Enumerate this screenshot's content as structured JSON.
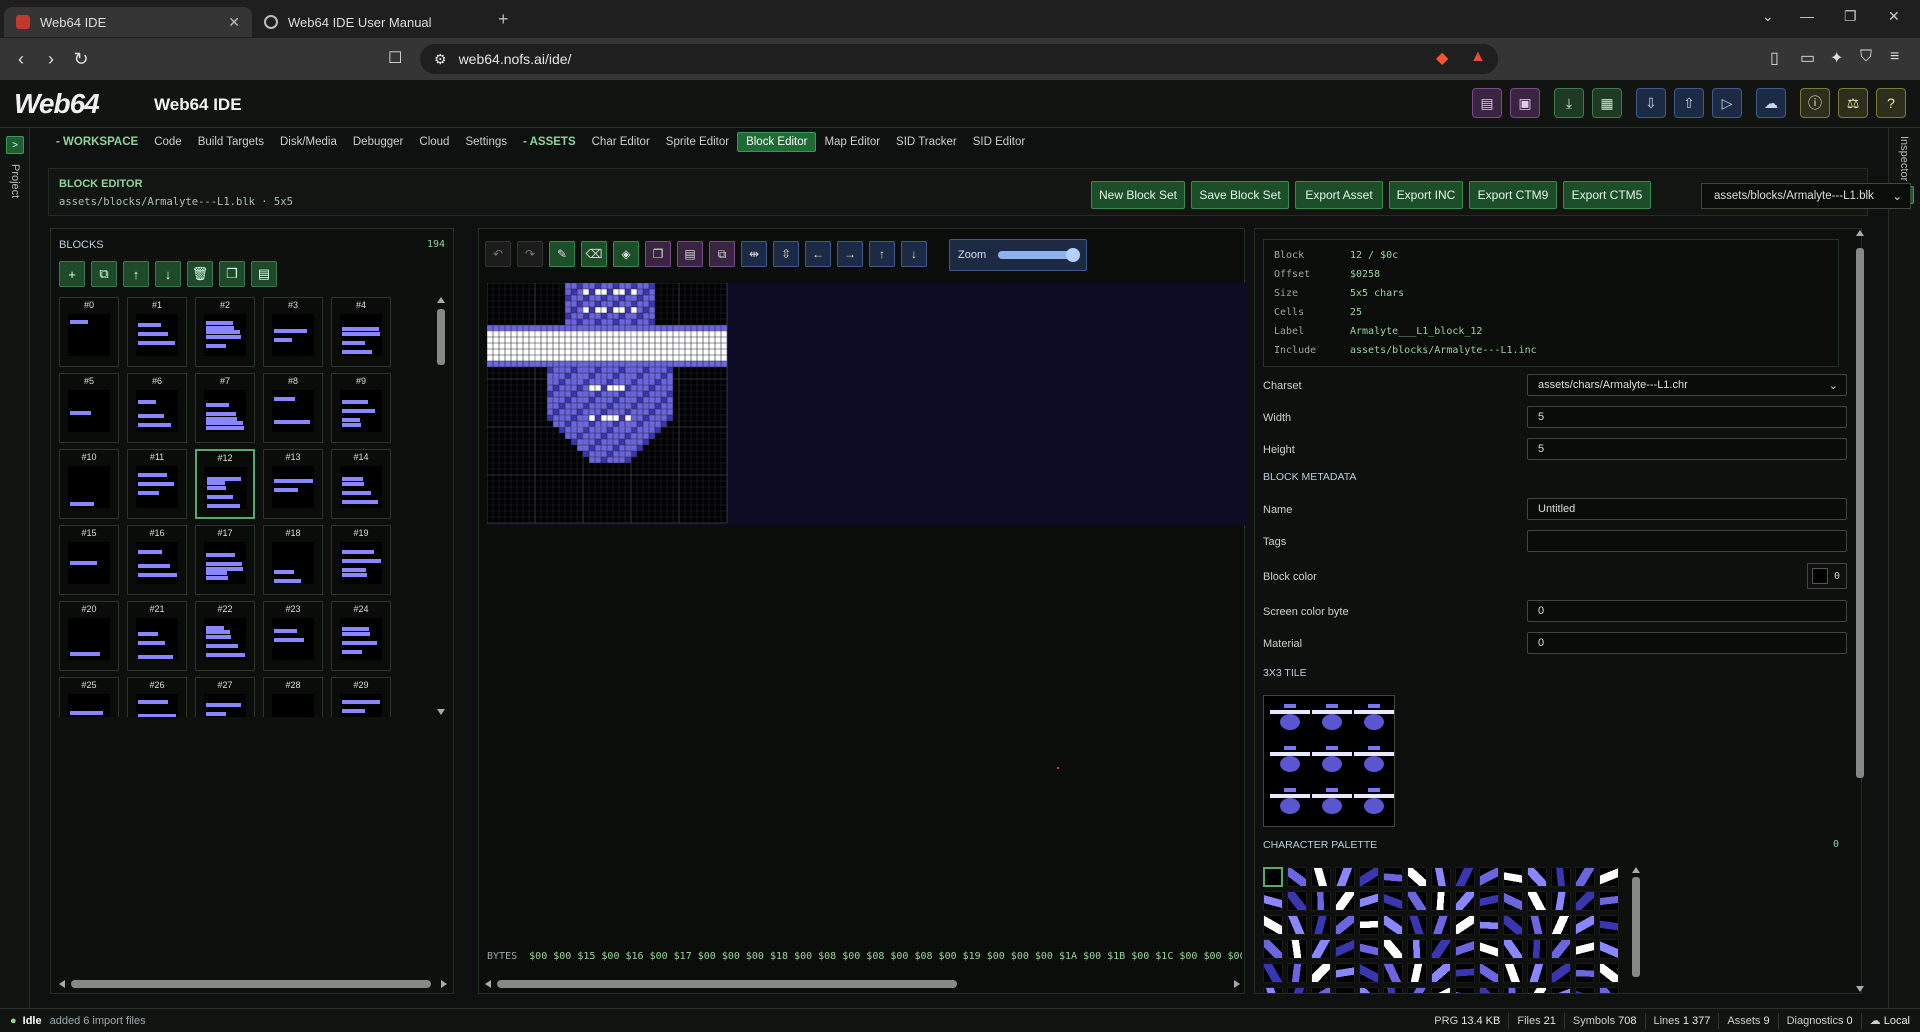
{
  "browser": {
    "tabs": [
      {
        "label": "Web64 IDE",
        "active": true
      },
      {
        "label": "Web64 IDE User Manual",
        "active": false
      }
    ],
    "url": "web64.nofs.ai/ide/"
  },
  "app": {
    "logo": "Web64",
    "title": "Web64 IDE",
    "header_buttons": [
      "new-file-icon",
      "save-icon",
      "download-icon",
      "save-disk-icon",
      "import-icon",
      "export-icon",
      "run-icon",
      "cloud-icon",
      "info-icon",
      "scale-icon",
      "help-icon"
    ]
  },
  "nav": {
    "workspace_label": "- WORKSPACE",
    "workspace_items": [
      "Code",
      "Build Targets",
      "Disk/Media",
      "Debugger",
      "Cloud",
      "Settings"
    ],
    "assets_label": "- ASSETS",
    "assets_items": [
      "Char Editor",
      "Sprite Editor",
      "Block Editor",
      "Map Editor",
      "SID Tracker",
      "SID Editor"
    ],
    "active": "Block Editor"
  },
  "rails": {
    "left_label": "Project",
    "right_label": "Inspector",
    "left_button": ">",
    "right_button": "<"
  },
  "editor": {
    "title": "BLOCK EDITOR",
    "path": "assets/blocks/Armalyte---L1.blk · 5x5",
    "buttons": [
      "New Block Set",
      "Save Block Set",
      "Export Asset",
      "Export INC",
      "Export CTM9",
      "Export CTM5"
    ],
    "file_select": "assets/blocks/Armalyte---L1.blk"
  },
  "blocks": {
    "header": "BLOCKS",
    "count": "194",
    "toolbar": [
      "add-icon",
      "duplicate-icon",
      "move-up-icon",
      "move-down-icon",
      "delete-icon",
      "copy-icon",
      "paste-icon"
    ],
    "items": [
      "#0",
      "#1",
      "#2",
      "#3",
      "#4",
      "#5",
      "#6",
      "#7",
      "#8",
      "#9",
      "#10",
      "#11",
      "#12",
      "#13",
      "#14",
      "#15",
      "#16",
      "#17",
      "#18",
      "#19",
      "#20",
      "#21",
      "#22",
      "#23",
      "#24",
      "#25",
      "#26",
      "#27",
      "#28",
      "#29"
    ],
    "selected": "#12"
  },
  "canvas": {
    "tools": [
      "undo-icon",
      "redo-icon",
      "pencil-icon",
      "eraser-icon",
      "fill-icon",
      "copy-icon",
      "paste-icon",
      "clone-icon",
      "flip-horizontal-icon",
      "flip-vertical-icon",
      "shift-left-icon",
      "shift-right-icon",
      "shift-up-icon",
      "shift-down-icon"
    ],
    "zoom_label": "Zoom",
    "zoom_level": 1.0,
    "bytes_label": "BYTES",
    "bytes": "$00 $00 $15 $00 $16 $00 $17 $00 $00 $00 $18 $00 $08 $00 $08 $00 $08 $00 $19 $00 $00 $00 $1A $00 $1B $00 $1C $00 $00 $00"
  },
  "inspector": {
    "info": [
      {
        "key": "Block",
        "value": "12 / $0c"
      },
      {
        "key": "Offset",
        "value": "$0258"
      },
      {
        "key": "Size",
        "value": "5x5 chars"
      },
      {
        "key": "Cells",
        "value": "25"
      },
      {
        "key": "Label",
        "value": "Armalyte___L1_block_12"
      },
      {
        "key": "Include",
        "value": "assets/blocks/Armalyte---L1.inc"
      }
    ],
    "charset_label": "Charset",
    "charset_value": "assets/chars/Armalyte---L1.chr",
    "width_label": "Width",
    "width_value": "5",
    "height_label": "Height",
    "height_value": "5",
    "metadata_header": "BLOCK METADATA",
    "name_label": "Name",
    "name_value": "Untitled",
    "tags_label": "Tags",
    "tags_value": "",
    "color_label": "Block color",
    "color_value": "0",
    "screen_label": "Screen color byte",
    "screen_value": "0",
    "material_label": "Material",
    "material_value": "0",
    "tile_header": "3X3 TILE",
    "palette_header": "CHARACTER PALETTE",
    "palette_selected": "0"
  },
  "status": {
    "state": "Idle",
    "message": "added 6 import files",
    "prg_label": "PRG",
    "prg_value": "13.4 KB",
    "files_label": "Files",
    "files_value": "21",
    "symbols_label": "Symbols",
    "symbols_value": "708",
    "lines_label": "Lines",
    "lines_value": "1 377",
    "assets_label": "Assets",
    "assets_value": "9",
    "diag_label": "Diagnostics",
    "diag_value": "0",
    "mode": "Local"
  },
  "colors": {
    "accent": "#8fd49c",
    "active_nav": "#1f6b35",
    "pixel_dark": "#3a36b0",
    "pixel_mid": "#6b66e0",
    "pixel_light": "#ffffff"
  }
}
